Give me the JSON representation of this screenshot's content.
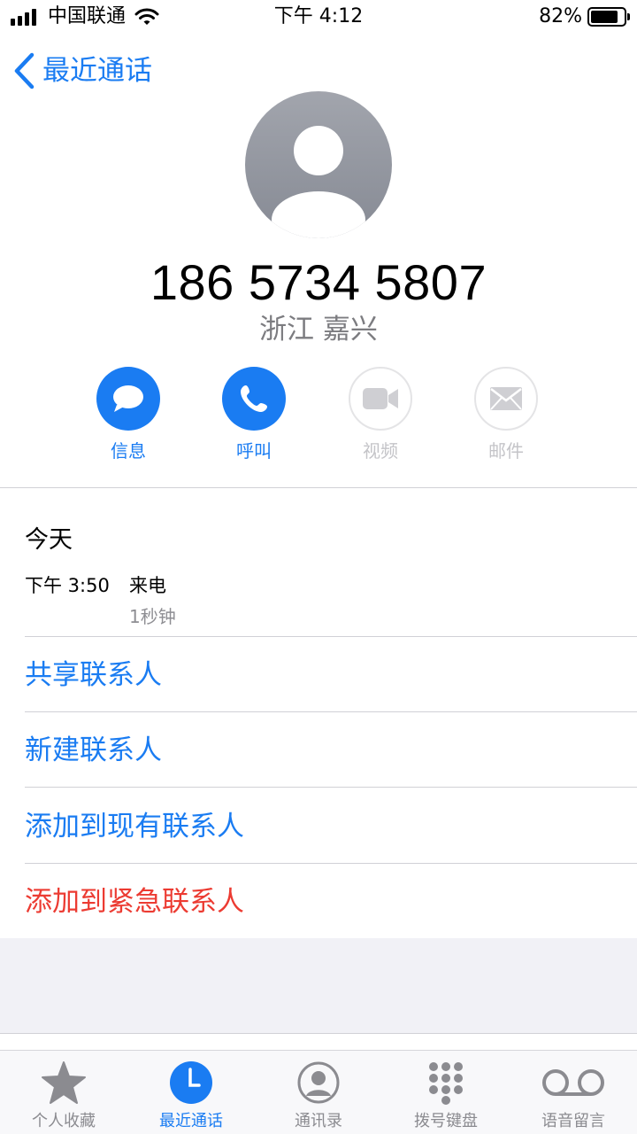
{
  "status_bar": {
    "carrier": "中国联通",
    "time": "下午 4:12",
    "battery_pct": "82%",
    "battery_level": 0.82,
    "icons": [
      "signal-icon",
      "wifi-icon",
      "battery-icon"
    ]
  },
  "nav": {
    "back_label": "最近通话",
    "back_icon": "chevron-left-icon"
  },
  "contact": {
    "avatar_icon": "person-placeholder-icon",
    "number": "186 5734 5807",
    "location": "浙江 嘉兴"
  },
  "actions": [
    {
      "label": "信息",
      "icon": "message-icon",
      "enabled": true
    },
    {
      "label": "呼叫",
      "icon": "phone-icon",
      "enabled": true
    },
    {
      "label": "视频",
      "icon": "video-icon",
      "enabled": false
    },
    {
      "label": "邮件",
      "icon": "mail-icon",
      "enabled": false
    }
  ],
  "call_log": {
    "day": "今天",
    "time": "下午 3:50",
    "type": "来电",
    "duration": "1秒钟"
  },
  "options": [
    {
      "label": "共享联系人",
      "color": "#1a7cf2"
    },
    {
      "label": "新建联系人",
      "color": "#1a7cf2"
    },
    {
      "label": "添加到现有联系人",
      "color": "#1a7cf2"
    },
    {
      "label": "添加到紧急联系人",
      "color": "#ec3b32"
    }
  ],
  "tabs": [
    {
      "label": "个人收藏",
      "icon": "star-icon",
      "active": false
    },
    {
      "label": "最近通话",
      "icon": "clock-icon",
      "active": true
    },
    {
      "label": "通讯录",
      "icon": "contacts-icon",
      "active": false
    },
    {
      "label": "拨号键盘",
      "icon": "keypad-icon",
      "active": false
    },
    {
      "label": "语音留言",
      "icon": "voicemail-icon",
      "active": false
    }
  ],
  "colors": {
    "accent": "#1a7cf2",
    "destructive": "#ec3b32",
    "disabled": "#c4c4c8"
  }
}
